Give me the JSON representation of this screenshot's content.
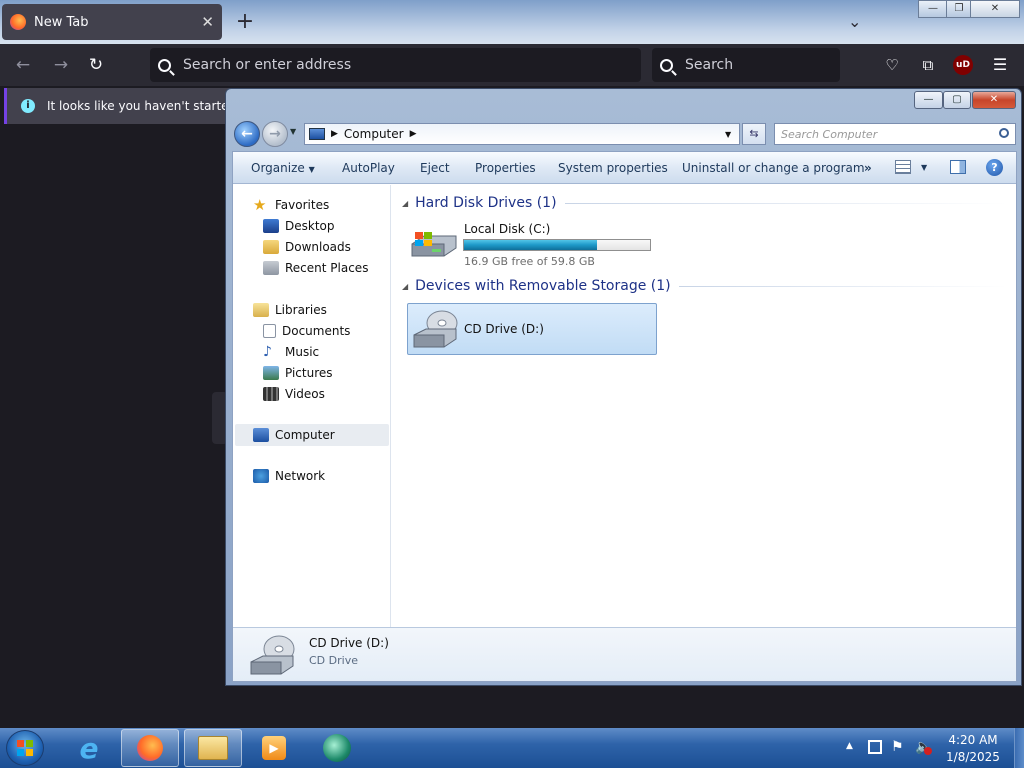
{
  "firefox": {
    "tab_title": "New Tab",
    "url_placeholder": "Search or enter address",
    "search_placeholder": "Search",
    "notification": "It looks like you haven't started Fir",
    "extension_badge": "uD"
  },
  "explorer": {
    "address": {
      "crumb": "Computer"
    },
    "search_placeholder": "Search Computer",
    "toolbar": {
      "organize": "Organize",
      "autoplay": "AutoPlay",
      "eject": "Eject",
      "properties": "Properties",
      "system_properties": "System properties",
      "uninstall": "Uninstall or change a program",
      "more": "»"
    },
    "nav": {
      "favorites": "Favorites",
      "desktop": "Desktop",
      "downloads": "Downloads",
      "recent_places": "Recent Places",
      "libraries": "Libraries",
      "documents": "Documents",
      "music": "Music",
      "pictures": "Pictures",
      "videos": "Videos",
      "computer": "Computer",
      "network": "Network"
    },
    "content": {
      "hard_disk_header": "Hard Disk Drives (1)",
      "local_disk": {
        "name": "Local Disk (C:)",
        "free_text": "16.9 GB free of 59.8 GB",
        "used_fraction": 0.717
      },
      "removable_header": "Devices with Removable Storage (1)",
      "cd_drive": {
        "name": "CD Drive (D:)"
      }
    },
    "details": {
      "name": "CD Drive (D:)",
      "type": "CD Drive"
    }
  },
  "taskbar": {
    "clock_time": "4:20 AM",
    "clock_date": "1/8/2025"
  }
}
